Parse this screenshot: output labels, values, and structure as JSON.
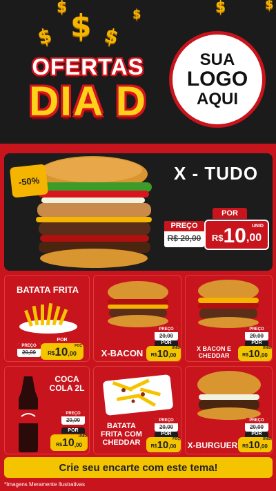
{
  "header": {
    "title_top": "OFERTAS",
    "title_bottom": "DIA D",
    "logo_line1": "SUA",
    "logo_line2": "LOGO",
    "logo_line3": "AQUI",
    "coin_symbol": "$"
  },
  "featured": {
    "badge": "-50%",
    "name": "X - TUDO",
    "por_label": "POR",
    "preco_label": "PREÇO",
    "old_price": "R$ 20,00",
    "currency": "R$",
    "price_int": "10",
    "price_dec": ",00",
    "unit": "UNID"
  },
  "cards": [
    {
      "title": "BATATA FRITA",
      "preco_label": "PREÇO",
      "old_price": "20,00",
      "por_label": "POR",
      "currency": "R$",
      "price_int": "10",
      "price_dec": ",00",
      "unit": "POÇ"
    },
    {
      "title": "X-BACON",
      "preco_label": "PREÇO",
      "old_price": "20,00",
      "por_label": "POR",
      "currency": "R$",
      "price_int": "10",
      "price_dec": ",00",
      "unit": "UNID"
    },
    {
      "title": "X BACON E CHEDDAR",
      "preco_label": "PREÇO",
      "old_price": "20,00",
      "por_label": "POR",
      "currency": "R$",
      "price_int": "10",
      "price_dec": ",00",
      "unit": "UNID"
    },
    {
      "title": "COCA COLA 2L",
      "preco_label": "PREÇO",
      "old_price": "20,00",
      "por_label": "POR",
      "currency": "R$",
      "price_int": "10",
      "price_dec": ",00",
      "unit": "UNID"
    },
    {
      "title": "BATATA FRITA COM CHEDDAR",
      "preco_label": "PREÇO",
      "old_price": "20,00",
      "por_label": "POR",
      "currency": "R$",
      "price_int": "10",
      "price_dec": ",00",
      "unit": "POÇ"
    },
    {
      "title": "X-BURGUER",
      "preco_label": "PREÇO",
      "old_price": "20,00",
      "por_label": "POR",
      "currency": "R$",
      "price_int": "10",
      "price_dec": ",00",
      "unit": "UNID"
    }
  ],
  "cta": "Crie seu encarte com este tema!",
  "disclaimer": "*Imagens Meramente Ilustrativas",
  "colors": {
    "red": "#c8141c",
    "yellow": "#f5c400",
    "dark": "#1c1c1c"
  }
}
